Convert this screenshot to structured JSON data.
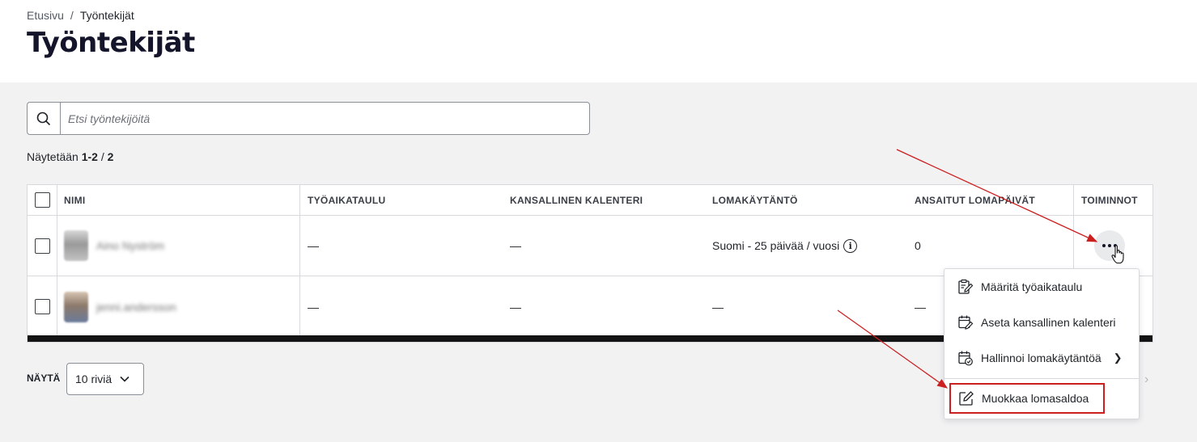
{
  "breadcrumb": {
    "home": "Etusivu",
    "separator": "/",
    "current": "Työntekijät"
  },
  "page_title": "Työntekijät",
  "search": {
    "placeholder": "Etsi työntekijöitä",
    "icon": "search-icon"
  },
  "result_count": {
    "prefix": "Näytetään",
    "range": "1-2",
    "sep": "/",
    "total": "2"
  },
  "table": {
    "columns": [
      "NIMI",
      "TYÖAIKATAULU",
      "KANSALLINEN KALENTERI",
      "LOMAKÄYTÄNTÖ",
      "ANSAITUT LOMAPÄIVÄT",
      "TOIMINNOT"
    ],
    "rows": [
      {
        "name": "Aino Nyström",
        "schedule": "—",
        "calendar": "—",
        "policy": "Suomi - 25 päivää / vuosi",
        "earned": "0"
      },
      {
        "name": "jenni.andersson",
        "schedule": "—",
        "calendar": "—",
        "policy": "—",
        "earned": "—"
      }
    ]
  },
  "footer": {
    "show_label": "NÄYTÄ",
    "rows_selected": "10 riviä"
  },
  "menu": {
    "items": [
      {
        "label": "Määritä työaikataulu",
        "icon": "schedule-edit-icon"
      },
      {
        "label": "Aseta kansallinen kalenteri",
        "icon": "calendar-edit-icon"
      },
      {
        "label": "Hallinnoi lomakäytäntöä",
        "icon": "calendar-check-icon"
      },
      {
        "label": "Muokkaa lomasaldoa",
        "icon": "edit-icon"
      }
    ]
  },
  "colors": {
    "annotation": "#cc1f1f",
    "title": "#14152b",
    "background": "#f2f2f3"
  }
}
